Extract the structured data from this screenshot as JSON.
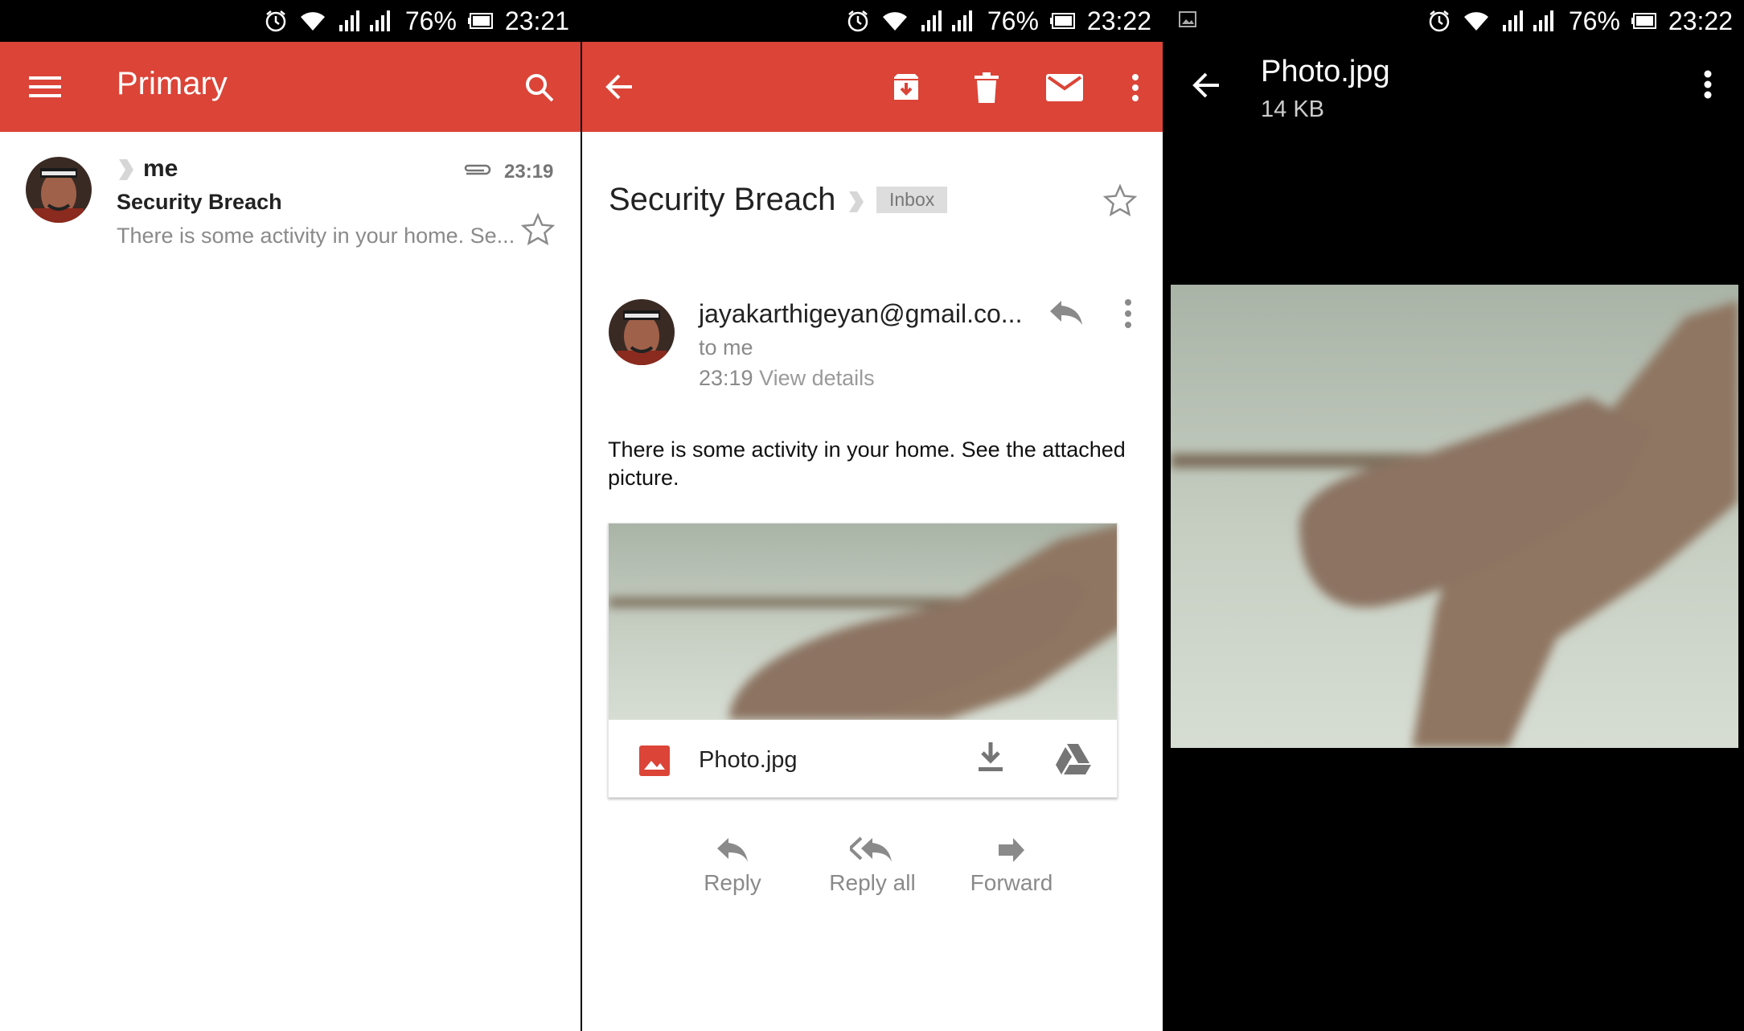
{
  "panel1": {
    "status": {
      "battery": "76%",
      "time": "23:21"
    },
    "appbar": {
      "title": "Primary"
    },
    "item": {
      "sender": "me",
      "time": "23:19",
      "subject": "Security Breach",
      "snippet": "There is some activity in your home. Se..."
    }
  },
  "panel2": {
    "status": {
      "battery": "76%",
      "time": "23:22"
    },
    "subject": "Security Breach",
    "label": "Inbox",
    "from": "jayakarthigeyan@gmail.co...",
    "to": "to me",
    "time": "23:19",
    "view_details": "View details",
    "body": "There is some activity in your home. See the attached picture.",
    "attachment": {
      "name": "Photo.jpg"
    },
    "actions": {
      "reply": "Reply",
      "reply_all": "Reply all",
      "forward": "Forward"
    }
  },
  "panel3": {
    "status": {
      "battery": "76%",
      "time": "23:22"
    },
    "title": "Photo.jpg",
    "size": "14 KB"
  },
  "colors": {
    "accent": "#db4437",
    "status_bar": "#000000",
    "viewer_bg": "#000000"
  },
  "icons": [
    "alarm-icon",
    "wifi-icon",
    "signal-icon",
    "battery-icon",
    "menu-icon",
    "search-icon",
    "back-icon",
    "archive-icon",
    "delete-icon",
    "mail-icon",
    "more-icon",
    "attachment-icon",
    "star-icon",
    "reply-icon",
    "reply-all-icon",
    "forward-icon",
    "image-file-icon",
    "download-icon",
    "drive-icon"
  ]
}
